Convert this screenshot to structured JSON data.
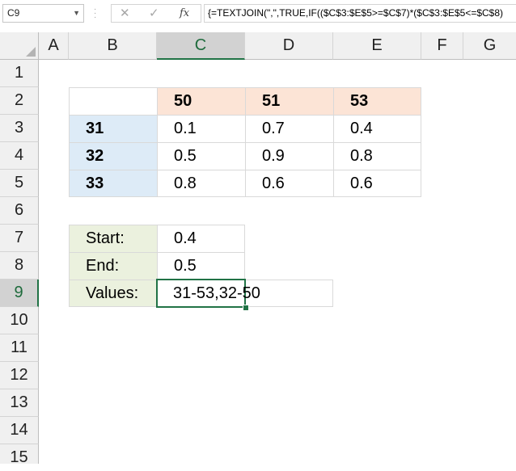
{
  "namebox": {
    "value": "C9"
  },
  "formula_bar": {
    "cancel_icon": "✕",
    "enter_icon": "✓",
    "fx_label": "fx",
    "formula": "{=TEXTJOIN(\",\",TRUE,IF(($C$3:$E$5>=$C$7)*($C$3:$E$5<=$C$8)"
  },
  "columns": [
    "A",
    "B",
    "C",
    "D",
    "E",
    "F",
    "G"
  ],
  "rows": [
    "1",
    "2",
    "3",
    "4",
    "5",
    "6",
    "7",
    "8",
    "9",
    "10",
    "11",
    "12",
    "13",
    "14",
    "15"
  ],
  "active_cell": {
    "column": "C",
    "row": "9"
  },
  "table": {
    "header": [
      "50",
      "51",
      "53"
    ],
    "row_labels": [
      "31",
      "32",
      "33"
    ],
    "cells": [
      [
        "0.1",
        "0.7",
        "0.4"
      ],
      [
        "0.5",
        "0.9",
        "0.8"
      ],
      [
        "0.8",
        "0.6",
        "0.6"
      ]
    ]
  },
  "criteria": {
    "start_label": "Start:",
    "start_value": "0.4",
    "end_label": "End:",
    "end_value": "0.5",
    "values_label": "Values:",
    "values_result": "31-53,32-50"
  },
  "colors": {
    "header_fill": "#fce4d6",
    "row_label_fill": "#ddebf7",
    "label_fill": "#ebf1de",
    "selection": "#217346"
  }
}
